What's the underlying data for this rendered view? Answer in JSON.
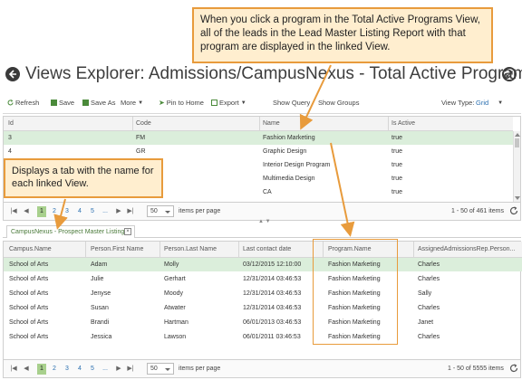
{
  "callouts": {
    "top": "When you click a program in the Total Active Programs View, all of the leads in the Lead Master Listing Report with that program are displayed in the linked View.",
    "left": "Displays a tab with the name for each linked View."
  },
  "header": {
    "title": "Views Explorer: Admissions/CampusNexus - Total Active Programs",
    "back_icon": "back-arrow-icon",
    "expand_icon": "expand-icon"
  },
  "toolbar": {
    "refresh": "Refresh",
    "save": "Save",
    "save_as": "Save As",
    "more": "More",
    "pin_to_home": "Pin to Home",
    "export": "Export",
    "show_query": "Show Query",
    "show_groups": "Show Groups",
    "view_type_label": "View Type:",
    "view_type_value": "Grid"
  },
  "top_grid": {
    "columns": [
      "Id",
      "Code",
      "Name",
      "Is Active"
    ],
    "rows": [
      [
        "3",
        "FM",
        "Fashion Marketing",
        "true"
      ],
      [
        "4",
        "GR",
        "Graphic Design",
        "true"
      ],
      [
        "",
        "",
        "Interior Design Program",
        "true"
      ],
      [
        "",
        "",
        "Multimedia Design",
        "true"
      ],
      [
        "",
        "",
        "CA",
        "true"
      ]
    ],
    "selected_row": 0,
    "pager": {
      "pages": [
        "1",
        "2",
        "3",
        "4",
        "5",
        "..."
      ],
      "current_page": "1",
      "page_size": "50",
      "items_per_page_label": "items per page",
      "count": "1 - 50 of 461 items"
    }
  },
  "tabs": {
    "active_label": "CampusNexus - Prospect Master Listing"
  },
  "bottom_grid": {
    "columns": [
      "Campus.Name",
      "Person.First Name",
      "Person.Last Name",
      "Last contact date",
      "Program.Name",
      "AssignedAdmissionsRep.Person..."
    ],
    "rows": [
      [
        "School of Arts",
        "Adam",
        "Molly",
        "03/12/2015 12:10:00",
        "Fashion Marketing",
        "Charles"
      ],
      [
        "School of Arts",
        "Julie",
        "Gerhart",
        "12/31/2014 03:46:53",
        "Fashion Marketing",
        "Charles"
      ],
      [
        "School of Arts",
        "Jenyse",
        "Moody",
        "12/31/2014 03:46:53",
        "Fashion Marketing",
        "Sally"
      ],
      [
        "School of Arts",
        "Susan",
        "Atwater",
        "12/31/2014 03:46:53",
        "Fashion Marketing",
        "Charles"
      ],
      [
        "School of Arts",
        "Brandi",
        "Hartman",
        "06/01/2013 03:46:53",
        "Fashion Marketing",
        "Janet"
      ],
      [
        "School of Arts",
        "Jessica",
        "Lawson",
        "06/01/2011 03:46:53",
        "Fashion Marketing",
        "Charles"
      ]
    ],
    "selected_row": 0,
    "pager": {
      "pages": [
        "1",
        "2",
        "3",
        "4",
        "5",
        "..."
      ],
      "current_page": "1",
      "page_size": "50",
      "items_per_page_label": "items per page",
      "count": "1 - 50 of 5555 items"
    }
  },
  "colors": {
    "callout_border": "#e89b3c",
    "callout_fill": "#ffeecf",
    "selected_row": "#dbeedb",
    "active_page": "#a8d08d",
    "link_blue": "#2a6fb0"
  }
}
